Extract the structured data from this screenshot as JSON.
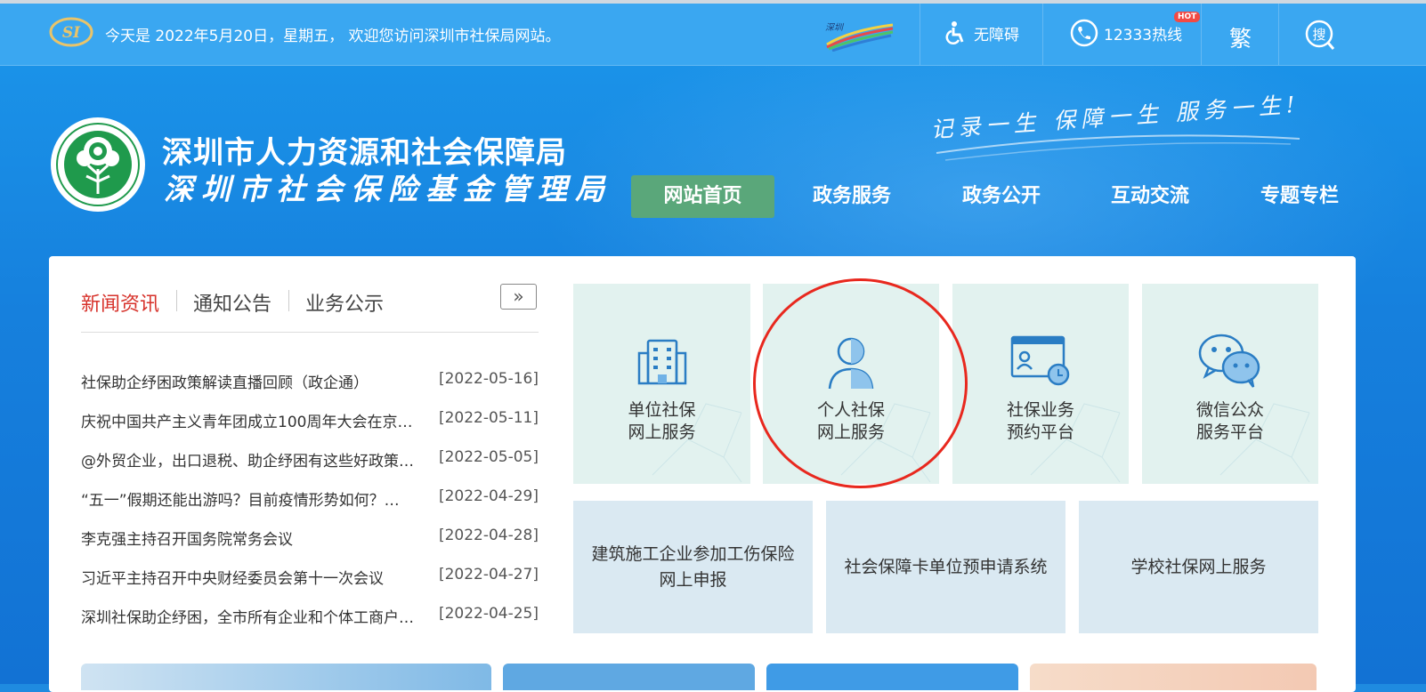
{
  "topbar": {
    "date_text": "今天是 2022年5月20日，星期五， 欢迎您访问深圳市社保局网站。",
    "accessibility_label": "无障碍",
    "hotline_label": "12333热线",
    "hot_badge": "HOT",
    "traditional_label": "繁",
    "search_label": "搜",
    "logo_text": "SI",
    "shenzhen_logo_text": "深圳"
  },
  "header": {
    "org_name_1": "深圳市人力资源和社会保障局",
    "org_name_2": "深圳市社会保险基金管理局",
    "slogan": "记录一生 保障一生 服务一生!"
  },
  "nav": {
    "items": [
      {
        "label": "网站首页",
        "active": true
      },
      {
        "label": "政务服务",
        "active": false
      },
      {
        "label": "政务公开",
        "active": false
      },
      {
        "label": "互动交流",
        "active": false
      },
      {
        "label": "专题专栏",
        "active": false
      }
    ]
  },
  "news": {
    "tabs": [
      {
        "label": "新闻资讯",
        "active": true
      },
      {
        "label": "通知公告",
        "active": false
      },
      {
        "label": "业务公示",
        "active": false
      }
    ],
    "more_label": "»",
    "items": [
      {
        "title": "社保助企纾困政策解读直播回顾（政企通）",
        "date": "[2022-05-16]"
      },
      {
        "title": "庆祝中国共产主义青年团成立100周年大会在京…",
        "date": "[2022-05-11]"
      },
      {
        "title": "@外贸企业，出口退税、助企纾困有这些好政策…",
        "date": "[2022-05-05]"
      },
      {
        "title": "“五一”假期还能出游吗？目前疫情形势如何？…",
        "date": "[2022-04-29]"
      },
      {
        "title": "李克强主持召开国务院常务会议",
        "date": "[2022-04-28]"
      },
      {
        "title": "习近平主持召开中央财经委员会第十一次会议",
        "date": "[2022-04-27]"
      },
      {
        "title": "深圳社保助企纾困，全市所有企业和个体工商户…",
        "date": "[2022-04-25]"
      }
    ]
  },
  "services": {
    "tiles": [
      {
        "line1": "单位社保",
        "line2": "网上服务",
        "icon": "building-icon"
      },
      {
        "line1": "个人社保",
        "line2": "网上服务",
        "icon": "person-icon"
      },
      {
        "line1": "社保业务",
        "line2": "预约平台",
        "icon": "appointment-icon"
      },
      {
        "line1": "微信公众",
        "line2": "服务平台",
        "icon": "wechat-icon"
      }
    ],
    "wide_tiles": [
      {
        "label": "建筑施工企业参加工伤保险网上申报"
      },
      {
        "label": "社会保障卡单位预申请系统"
      },
      {
        "label": "学校社保网上服务"
      }
    ]
  },
  "colors": {
    "topbar": "#3aa7f1",
    "banner": "#1680dd",
    "nav_active": "#5aa77a",
    "news_active": "#d7322b",
    "tile_bg": "#e2f2ef",
    "wide_tile_bg": "#dae9f2",
    "highlight_circle": "#e8281e"
  }
}
